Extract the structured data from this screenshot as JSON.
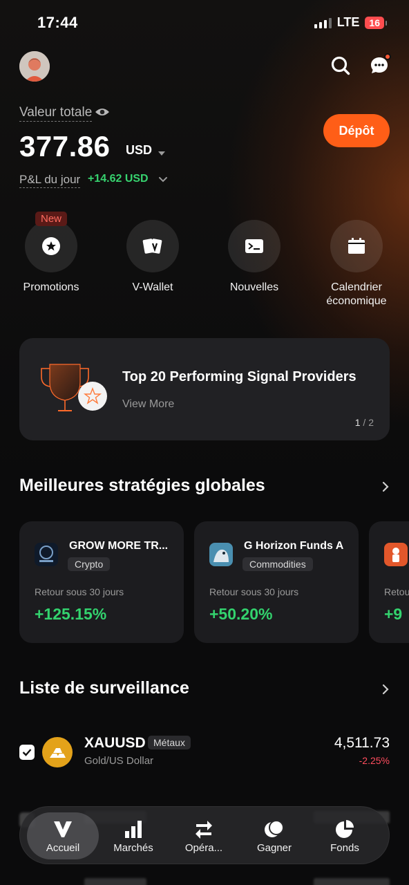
{
  "status_bar": {
    "time": "17:44",
    "network": "LTE",
    "battery": "16"
  },
  "header": {
    "avatar": "avatar",
    "search_icon": "search-icon",
    "chat_icon": "chat-icon"
  },
  "balance": {
    "total_label": "Valeur totale",
    "total_value": "377.86",
    "currency": "USD",
    "pnl_label": "P&L du jour",
    "pnl_value": "+14.62 USD",
    "deposit_label": "Dépôt"
  },
  "quick_actions": [
    {
      "label": "Promotions",
      "icon": "star-badge-icon",
      "badge": "New"
    },
    {
      "label": "V-Wallet",
      "icon": "v-wallet-icon"
    },
    {
      "label": "Nouvelles",
      "icon": "news-icon"
    },
    {
      "label": "Calendrier économique",
      "icon": "calendar-icon"
    }
  ],
  "promo": {
    "title": "Top 20 Performing Signal Providers",
    "link": "View More",
    "page_current": "1",
    "page_total": "/ 2"
  },
  "strategies": {
    "title": "Meilleures stratégies globales",
    "items": [
      {
        "name": "GROW MORE TR...",
        "tag": "Crypto",
        "metric": "Retour sous 30 jours",
        "value": "+125.15%"
      },
      {
        "name": "G Horizon Funds A",
        "tag": "Commodities",
        "metric": "Retour sous 30 jours",
        "value": "+50.20%"
      },
      {
        "name": "",
        "tag": "",
        "metric": "Retou",
        "value": "+9"
      }
    ]
  },
  "watchlist": {
    "title": "Liste de surveillance",
    "items": [
      {
        "symbol": "XAUUSD",
        "tag": "Métaux",
        "name": "Gold/US Dollar",
        "price": "4,511.73",
        "change": "-2.25%"
      }
    ]
  },
  "nav": [
    {
      "label": "Accueil",
      "icon": "home-v-icon",
      "active": true
    },
    {
      "label": "Marchés",
      "icon": "bar-chart-icon"
    },
    {
      "label": "Opéra...",
      "icon": "swap-arrows-icon"
    },
    {
      "label": "Gagner",
      "icon": "coins-icon"
    },
    {
      "label": "Fonds",
      "icon": "pie-chart-icon"
    }
  ],
  "colors": {
    "accent": "#ff5e17",
    "positive": "#33d36e",
    "negative": "#ff4d5e",
    "background": "#0b0b0c"
  }
}
